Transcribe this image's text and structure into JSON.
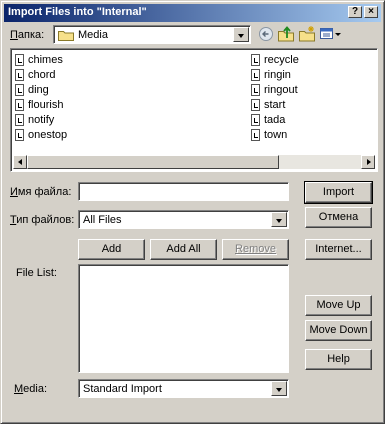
{
  "window": {
    "title": "Import Files into \"Internal\"",
    "help_glyph": "?",
    "close_glyph": "×"
  },
  "lookin": {
    "label_u": "П",
    "label_rest": "апка:",
    "value": "Media"
  },
  "files": {
    "column1": [
      "chimes",
      "chord",
      "ding",
      "flourish",
      "notify",
      "onestop"
    ],
    "column2": [
      "recycle",
      "ringin",
      "ringout",
      "start",
      "tada",
      "town"
    ]
  },
  "filename": {
    "label_u": "И",
    "label_rest": "мя файла:",
    "value": ""
  },
  "filetype": {
    "label_u": "Т",
    "label_rest": "ип файлов:",
    "value": "All Files"
  },
  "buttons": {
    "import": "Import",
    "cancel": "Отмена",
    "add": "Add",
    "add_all": "Add All",
    "remove": "Remove",
    "internet": "Internet...",
    "move_up": "Move Up",
    "move_down": "Move Down",
    "help": "Help"
  },
  "filelist": {
    "label": "File List:"
  },
  "media": {
    "label_u": "M",
    "label_rest": "edia:",
    "value": "Standard Import"
  },
  "colors": {
    "title_start": "#0a246a",
    "title_end": "#a6caf0",
    "face": "#d4d0c8"
  },
  "icons": [
    "folder-icon",
    "back-icon",
    "up-folder-icon",
    "new-folder-icon",
    "view-menu-icon",
    "file-icon"
  ]
}
